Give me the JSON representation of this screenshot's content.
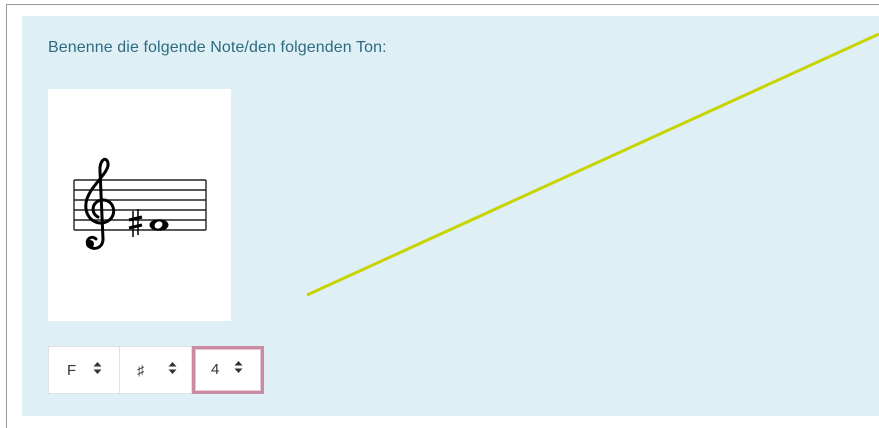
{
  "question": {
    "prompt": "Benenne die folgende Note/den folgenden Ton:"
  },
  "notation_image": {
    "clef": "treble",
    "accidental": "sharp",
    "note": "whole-note"
  },
  "answer_selects": [
    {
      "value": "F",
      "icon": "updown-caret-icon"
    },
    {
      "value": "♯",
      "icon": "updown-caret-icon"
    },
    {
      "value": "4",
      "icon": "updown-caret-icon",
      "focused": true
    }
  ],
  "colors": {
    "panel": "#def0f5",
    "prompt_text": "#2e6a80",
    "annotation_line": "#c8d400",
    "focus_border": "#c98aa3"
  }
}
